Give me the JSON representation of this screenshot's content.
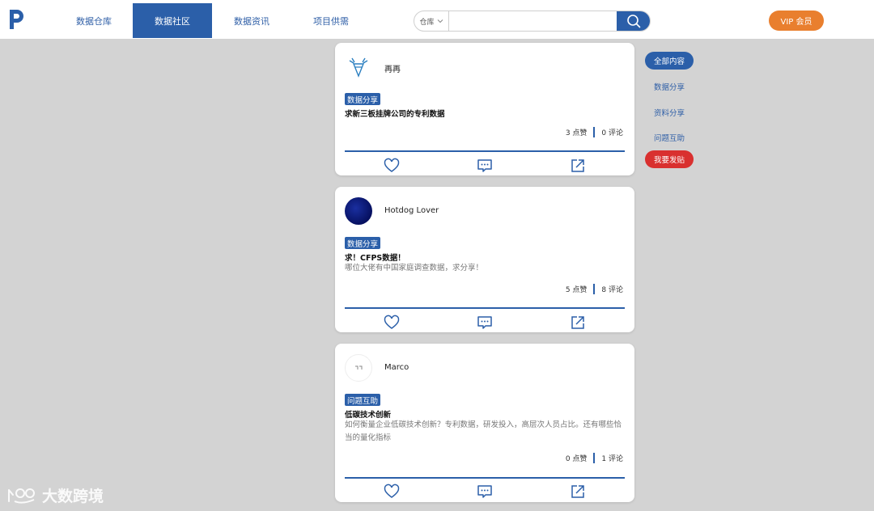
{
  "header": {
    "nav": [
      {
        "label": "数据仓库"
      },
      {
        "label": "数据社区"
      },
      {
        "label": "数据资讯"
      },
      {
        "label": "项目供需"
      }
    ],
    "search": {
      "scope": "仓库",
      "value": "",
      "placeholder": ""
    },
    "vip_label": "VIP 会员"
  },
  "posts": [
    {
      "author": "再再",
      "tag": "数据分享",
      "title": "求新三板挂牌公司的专利数据",
      "desc": "",
      "likes": "3 点赞",
      "comments": "0 评论"
    },
    {
      "author": "Hotdog Lover",
      "tag": "数据分享",
      "title": "求！CFPS数据！",
      "desc": "哪位大佬有中国家庭调查数据，求分享！",
      "likes": "5 点赞",
      "comments": "8 评论"
    },
    {
      "author": "Marco",
      "tag": "问题互助",
      "title": "低碳技术创新",
      "desc": "如何衡量企业低碳技术创新？专利数据，研发投入，高层次人员占比。还有哪些恰当的量化指标",
      "likes": "0 点赞",
      "comments": "1 评论"
    }
  ],
  "sidebar": {
    "items": [
      {
        "label": "全部内容"
      },
      {
        "label": "数据分享"
      },
      {
        "label": "资料分享"
      },
      {
        "label": "问题互助"
      }
    ],
    "post_label": "我要发贴"
  },
  "watermark": {
    "text": "大数跨境"
  },
  "icons": {
    "like": "heart-icon",
    "comment": "comment-icon",
    "share": "share-icon",
    "search": "search-icon"
  },
  "colors": {
    "primary": "#2b5fa9",
    "vip": "#e97f2e",
    "post": "#d9302f",
    "background": "#d3d3d3"
  }
}
